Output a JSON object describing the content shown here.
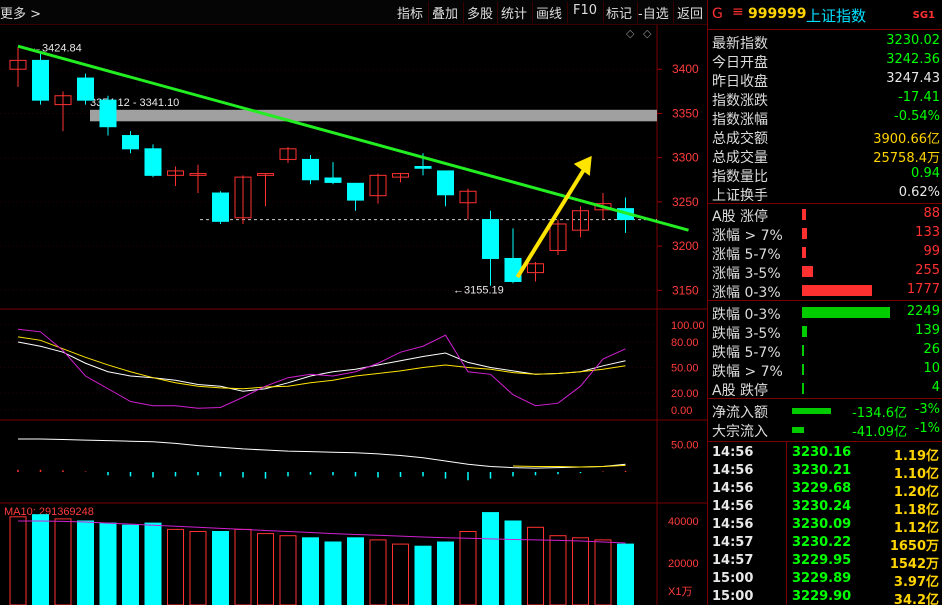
{
  "toolbar": {
    "more": "更多 >",
    "buttons": [
      "指标",
      "叠加",
      "多股",
      "统计",
      "画线",
      "F10",
      "标记",
      "-自选",
      "返回"
    ]
  },
  "header": {
    "g": "G",
    "menu": "≡",
    "code": "999999",
    "name": "上证指数",
    "sg": "SG1"
  },
  "quote": [
    {
      "label": "最新指数",
      "value": "3230.02",
      "color": "#00ff00"
    },
    {
      "label": "今日开盘",
      "value": "3242.36",
      "color": "#00ff00"
    },
    {
      "label": "昨日收盘",
      "value": "3247.43",
      "color": "#e8e8e8"
    },
    {
      "label": "指数涨跌",
      "value": "-17.41",
      "color": "#00ff00"
    },
    {
      "label": "指数涨幅",
      "value": "-0.54%",
      "color": "#00ff00"
    },
    {
      "label": "总成交额",
      "value": "3900.66亿",
      "color": "#ffd400"
    },
    {
      "label": "总成交量",
      "value": "25758.4万",
      "color": "#ffd400"
    },
    {
      "label": "指数量比",
      "value": "0.94",
      "color": "#00ff00"
    },
    {
      "label": "上证换手",
      "value": "0.62%",
      "color": "#e8e8e8"
    }
  ],
  "breadth": [
    {
      "label": "A股 涨停",
      "value": "88",
      "color": "#ff3030",
      "barColor": "#ff3030",
      "frac": 0.04
    },
    {
      "label": "涨幅 > 7%",
      "value": "133",
      "color": "#ff3030",
      "barColor": "#ff3030",
      "frac": 0.06
    },
    {
      "label": "涨幅 5-7%",
      "value": "99",
      "color": "#ff3030",
      "barColor": "#ff3030",
      "frac": 0.045
    },
    {
      "label": "涨幅 3-5%",
      "value": "255",
      "color": "#ff3030",
      "barColor": "#ff3030",
      "frac": 0.12
    },
    {
      "label": "涨幅 0-3%",
      "value": "1777",
      "color": "#ff3030",
      "barColor": "#ff3030",
      "frac": 0.8
    },
    {
      "label": "跌幅 0-3%",
      "value": "2249",
      "color": "#00ff00",
      "barColor": "#00cc00",
      "frac": 1.0
    },
    {
      "label": "跌幅 3-5%",
      "value": "139",
      "color": "#00ff00",
      "barColor": "#00cc00",
      "frac": 0.06
    },
    {
      "label": "跌幅 5-7%",
      "value": "26",
      "color": "#00ff00",
      "barColor": "#00cc00",
      "frac": 0.012
    },
    {
      "label": "跌幅 > 7%",
      "value": "10",
      "color": "#00ff00",
      "barColor": "#00cc00",
      "frac": 0.006
    },
    {
      "label": "A股 跌停",
      "value": "4",
      "color": "#00ff00",
      "barColor": "#00cc00",
      "frac": 0.003
    }
  ],
  "flows": [
    {
      "label": "净流入额",
      "value": "-134.6亿",
      "pct": "-3%",
      "frac": 0.85
    },
    {
      "label": "大宗流入",
      "value": "-41.09亿",
      "pct": "-1%",
      "frac": 0.26
    }
  ],
  "ticks": [
    {
      "time": "14:56",
      "price": "3230.16",
      "vol": "1.19亿",
      "color": "#00ff00"
    },
    {
      "time": "14:56",
      "price": "3230.21",
      "vol": "1.10亿",
      "color": "#00ff00"
    },
    {
      "time": "14:56",
      "price": "3229.68",
      "vol": "1.20亿",
      "color": "#00ff00"
    },
    {
      "time": "14:56",
      "price": "3230.24",
      "vol": "1.18亿",
      "color": "#00ff00"
    },
    {
      "time": "14:56",
      "price": "3230.09",
      "vol": "1.12亿",
      "color": "#00ff00"
    },
    {
      "time": "14:57",
      "price": "3230.22",
      "vol": "1650万",
      "color": "#00ff00"
    },
    {
      "time": "14:57",
      "price": "3229.95",
      "vol": "1542万",
      "color": "#00ff00"
    },
    {
      "time": "15:00",
      "price": "3229.89",
      "vol": "3.97亿",
      "color": "#00ff00"
    },
    {
      "time": "15:00",
      "price": "3229.90",
      "vol": "34.2亿",
      "color": "#00ff00"
    }
  ],
  "chart_data": {
    "type": "candlestick",
    "price_axis": {
      "ylim": [
        3130,
        3450
      ],
      "ticks": [
        3150,
        3200,
        3250,
        3300,
        3350,
        3400
      ]
    },
    "up_color": "#ff3232",
    "down_color": "#00ffff",
    "candles": [
      {
        "o": 3400,
        "h": 3424.84,
        "l": 3380,
        "c": 3410
      },
      {
        "o": 3410,
        "h": 3420,
        "l": 3360,
        "c": 3365
      },
      {
        "o": 3360,
        "h": 3375,
        "l": 3330,
        "c": 3370
      },
      {
        "o": 3390,
        "h": 3395,
        "l": 3360,
        "c": 3365
      },
      {
        "o": 3365,
        "h": 3370,
        "l": 3325,
        "c": 3335
      },
      {
        "o": 3325,
        "h": 3330,
        "l": 3305,
        "c": 3310
      },
      {
        "o": 3310,
        "h": 3315,
        "l": 3278,
        "c": 3280
      },
      {
        "o": 3280,
        "h": 3290,
        "l": 3268,
        "c": 3285
      },
      {
        "o": 3280,
        "h": 3292,
        "l": 3260,
        "c": 3282
      },
      {
        "o": 3260,
        "h": 3262,
        "l": 3225,
        "c": 3228
      },
      {
        "o": 3232,
        "h": 3280,
        "l": 3225,
        "c": 3278
      },
      {
        "o": 3280,
        "h": 3282,
        "l": 3245,
        "c": 3282
      },
      {
        "o": 3298,
        "h": 3312,
        "l": 3294,
        "c": 3310
      },
      {
        "o": 3298,
        "h": 3303,
        "l": 3270,
        "c": 3275
      },
      {
        "o": 3277,
        "h": 3295,
        "l": 3270,
        "c": 3272
      },
      {
        "o": 3271,
        "h": 3270,
        "l": 3240,
        "c": 3252
      },
      {
        "o": 3257,
        "h": 3282,
        "l": 3248,
        "c": 3280
      },
      {
        "o": 3278,
        "h": 3283,
        "l": 3272,
        "c": 3282
      },
      {
        "o": 3290,
        "h": 3305,
        "l": 3280,
        "c": 3288
      },
      {
        "o": 3285,
        "h": 3285,
        "l": 3245,
        "c": 3258
      },
      {
        "o": 3249,
        "h": 3265,
        "l": 3230,
        "c": 3262
      },
      {
        "o": 3230,
        "h": 3240,
        "l": 3155.19,
        "c": 3186
      },
      {
        "o": 3186,
        "h": 3220,
        "l": 3158,
        "c": 3160
      },
      {
        "o": 3170,
        "h": 3182,
        "l": 3160,
        "c": 3180
      },
      {
        "o": 3195,
        "h": 3230,
        "l": 3190,
        "c": 3225
      },
      {
        "o": 3218,
        "h": 3245,
        "l": 3210,
        "c": 3240
      },
      {
        "o": 3241,
        "h": 3260,
        "l": 3230,
        "c": 3248
      },
      {
        "o": 3242.36,
        "h": 3255,
        "l": 3215,
        "c": 3230.02
      }
    ],
    "annotations": {
      "high_label": "3424.84",
      "low_label": "3155.19",
      "zone_label": "3354.12 - 3341.10",
      "zone": [
        3341.1,
        3354.12
      ],
      "ref_price": 3230
    },
    "trendline": {
      "start": [
        0,
        3426
      ],
      "end": [
        29.8,
        3218
      ],
      "color": "#22ee22"
    },
    "arrow": {
      "start": [
        22.2,
        3165
      ],
      "end": [
        25.5,
        3302
      ],
      "color": "#ffe400"
    },
    "osc": {
      "ticks": [
        "100.00",
        "80.00",
        "50.00",
        "20.00",
        "0.00"
      ],
      "tick_values": [
        100,
        80,
        50,
        20,
        0
      ],
      "series": [
        {
          "name": "",
          "color": "#ffffff",
          "values": [
            80,
            75,
            68,
            55,
            45,
            40,
            38,
            35,
            30,
            28,
            22,
            25,
            32,
            40,
            45,
            48,
            53,
            58,
            63,
            67,
            56,
            50,
            46,
            42,
            43,
            45,
            52,
            58
          ]
        },
        {
          "name": "",
          "color": "#ffe400",
          "values": [
            86,
            82,
            72,
            62,
            53,
            45,
            38,
            32,
            28,
            26,
            25,
            27,
            28,
            32,
            35,
            40,
            43,
            46,
            50,
            53,
            50,
            48,
            44,
            42,
            43,
            45,
            48,
            52
          ]
        },
        {
          "name": "",
          "color": "#d020d0",
          "values": [
            95,
            92,
            70,
            40,
            25,
            10,
            5,
            5,
            2,
            3,
            15,
            28,
            38,
            42,
            40,
            45,
            55,
            68,
            75,
            88,
            45,
            42,
            18,
            5,
            8,
            28,
            60,
            72
          ]
        }
      ]
    },
    "macd": {
      "ticks": [
        "50.00"
      ],
      "dif": {
        "color": "#ffffff",
        "values": [
          60,
          60,
          59,
          58,
          57,
          56,
          55,
          52,
          48,
          45,
          42,
          40,
          38,
          37,
          36,
          35,
          33,
          30,
          26,
          20,
          14,
          10,
          8,
          7,
          8,
          9,
          10,
          14
        ]
      },
      "dea": {
        "color": "#ffe400",
        "values": [
          null,
          null,
          null,
          null,
          null,
          null,
          null,
          null,
          null,
          null,
          null,
          null,
          null,
          null,
          null,
          null,
          null,
          null,
          null,
          null,
          null,
          null,
          11,
          10,
          10,
          9,
          10,
          12
        ]
      },
      "bars": [
        4,
        4,
        3,
        1,
        -6,
        -8,
        -10,
        -8,
        -6,
        -8,
        -10,
        -12,
        -8,
        -5,
        -6,
        -8,
        -10,
        -9,
        -8,
        -12,
        -15,
        -12,
        -8,
        -6,
        -4,
        -2,
        1,
        2
      ]
    },
    "volume": {
      "ma_label": "MA10: 291369248",
      "unit_label": "X1万",
      "ticks": [
        "40000",
        "20000"
      ],
      "tick_values": [
        40000,
        20000
      ],
      "values": [
        42000,
        43000,
        41000,
        40000,
        39000,
        38000,
        39000,
        36000,
        35000,
        35000,
        36000,
        34000,
        33000,
        32000,
        30000,
        32000,
        31000,
        29000,
        28000,
        30000,
        35000,
        44000,
        40000,
        37000,
        33000,
        32000,
        31000,
        29000
      ],
      "ma_values": [
        40000,
        40000,
        39800,
        39500,
        39000,
        38500,
        38000,
        37500,
        37000,
        36500,
        36000,
        35500,
        35000,
        34500,
        34000,
        33600,
        33200,
        32800,
        32400,
        32000,
        31800,
        31500,
        31200,
        31000,
        30800,
        30500,
        30000,
        29500
      ]
    }
  }
}
